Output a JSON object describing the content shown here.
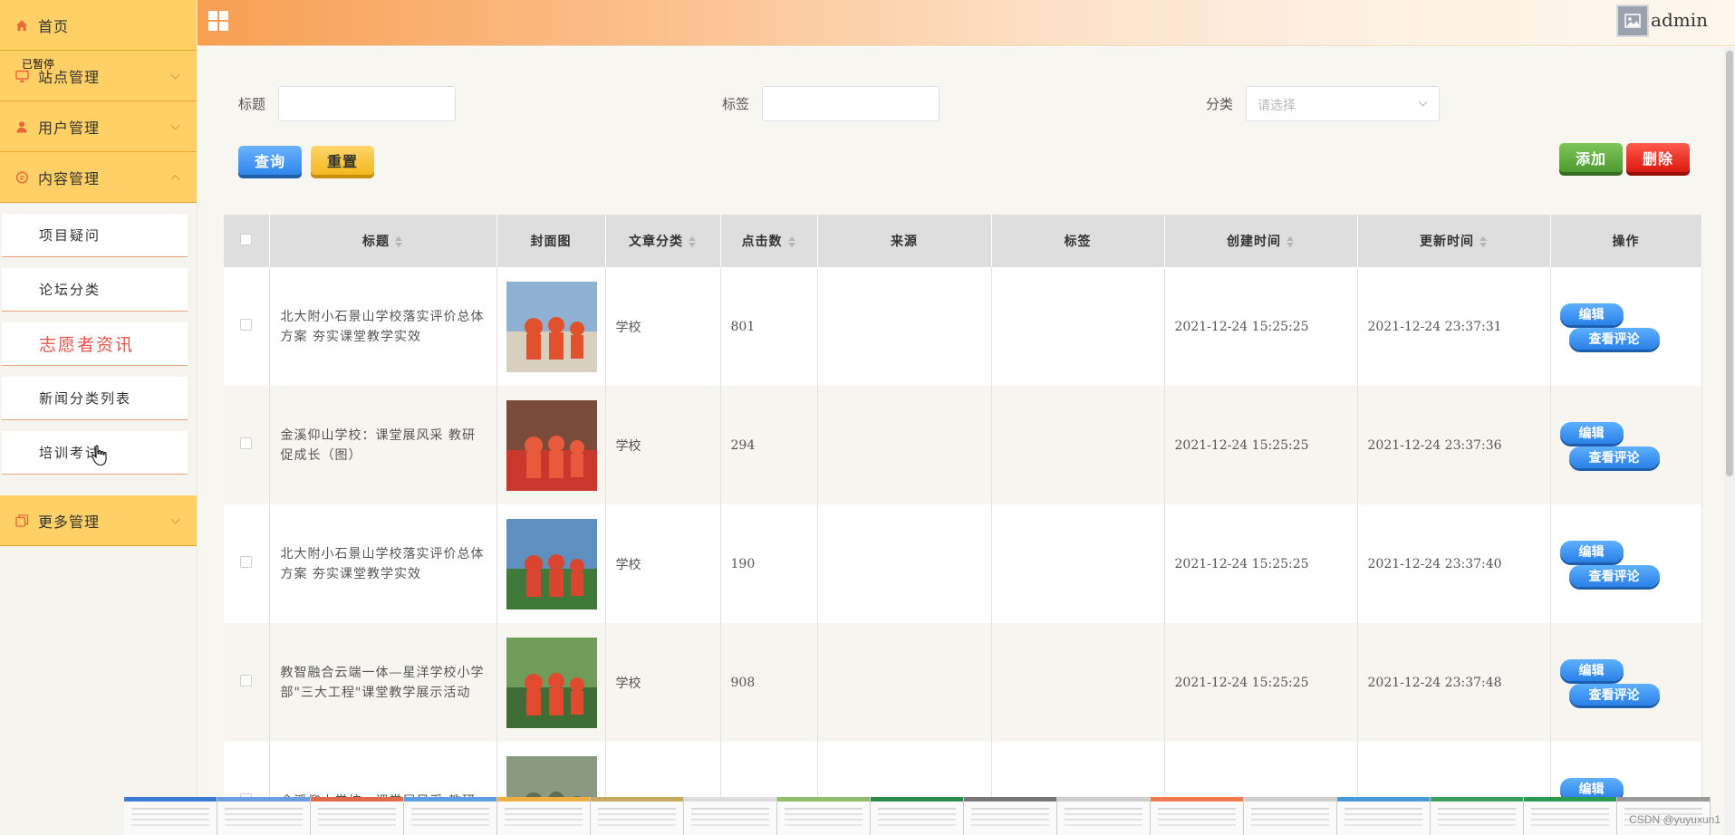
{
  "sidebar": {
    "home": "首页",
    "site_mgmt": "站点管理",
    "user_mgmt": "用户管理",
    "content_mgmt": "内容管理",
    "sub_items": [
      "项目疑问",
      "论坛分类",
      "志愿者资讯",
      "新闻分类列表",
      "培训考试"
    ],
    "more_mgmt": "更多管理",
    "overlay_tag": "已暂停"
  },
  "header": {
    "user_name": "admin"
  },
  "filters": {
    "title_label": "标题",
    "tag_label": "标签",
    "category_label": "分类",
    "category_placeholder": "请选择"
  },
  "actions": {
    "query": "查询",
    "reset": "重置",
    "add": "添加",
    "delete": "删除"
  },
  "table": {
    "columns": [
      "标题",
      "封面图",
      "文章分类",
      "点击数",
      "来源",
      "标签",
      "创建时间",
      "更新时间",
      "操作"
    ],
    "edit_label": "编辑",
    "comments_label": "查看评论",
    "rows": [
      {
        "title": "北大附小石景山学校落实评价总体方案 夯实课堂教学实效",
        "category": "学校",
        "clicks": "801",
        "source": "",
        "tag": "",
        "created": "2021-12-24 15:25:25",
        "updated": "2021-12-24 23:37:31"
      },
      {
        "title": "金溪仰山学校：课堂展风采 教研促成长（图）",
        "category": "学校",
        "clicks": "294",
        "source": "",
        "tag": "",
        "created": "2021-12-24 15:25:25",
        "updated": "2021-12-24 23:37:36"
      },
      {
        "title": "北大附小石景山学校落实评价总体方案 夯实课堂教学实效",
        "category": "学校",
        "clicks": "190",
        "source": "",
        "tag": "",
        "created": "2021-12-24 15:25:25",
        "updated": "2021-12-24 23:37:40"
      },
      {
        "title": "教智融合云端一体—星洋学校小学部\"三大工程\"课堂教学展示活动",
        "category": "学校",
        "clicks": "908",
        "source": "",
        "tag": "",
        "created": "2021-12-24 15:25:25",
        "updated": "2021-12-24 23:37:48"
      },
      {
        "title": "金溪仰山学校：课堂展风采 教研",
        "category": "",
        "clicks": "",
        "source": "",
        "tag": "",
        "created": "",
        "updated": ""
      }
    ]
  },
  "colors": {
    "sidebar_item": "#ffd066",
    "accent_blue": "#2e86ea",
    "accent_red": "#d9180e",
    "accent_green": "#4d9a31",
    "active_sub": "#e1574b"
  },
  "watermark": "CSDN @yuyuxun1"
}
